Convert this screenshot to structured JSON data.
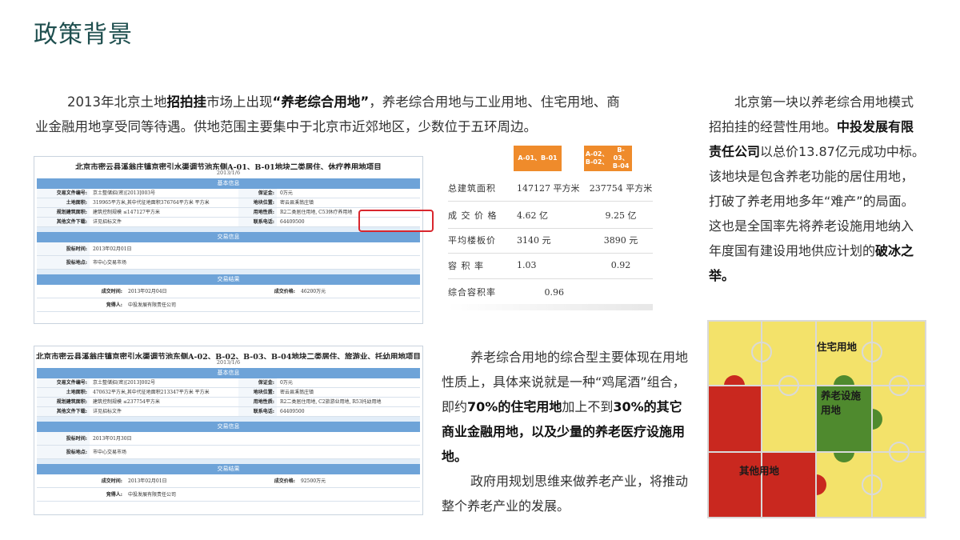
{
  "page": {
    "title": "政策背景",
    "intro": {
      "t1": "2013年北京土地",
      "b1": "招拍挂",
      "t2": "市场上出现",
      "b2": "“养老综合用地”",
      "t3": "，养老综合用地与工业用地、住宅用地、商业金融用地享受同等待遇。供地范围主要集中于北京市近郊地区，少数位于五环周边。"
    }
  },
  "doc1": {
    "title": "北京市密云县溪翁庄镇京密引水渠调节池东侧A-01、B-01地块二类居住、休疗养用地项目",
    "date": "2013/1/6",
    "band_basic": "基本信息",
    "band_trade": "交易信息",
    "band_result": "交易结果",
    "rows": {
      "file_no_label": "交易文件编号:",
      "file_no": "京土整储招(密)[2013]003号",
      "deposit_label": "保证金:",
      "deposit": "0万元",
      "area_label": "土地面积:",
      "area": "319965平方米,其中代征地面积376764平方米  平方米",
      "location_label": "地块位置:",
      "location": "密云县溪翁庄镇",
      "planning_label": "规划建筑面积:",
      "planning": "建筑控制规模 ≤147127平方米",
      "use_label": "用地性质:",
      "use": "R2二类居住用地,",
      "use_highlight": "C53休疗养用地",
      "download_label": "其他文件下载:",
      "download": "详见招标文件",
      "phone_label": "联系电话:",
      "phone": "64409500",
      "bid_time_label": "投标时间:",
      "bid_time": "2013年02月01日",
      "bid_place_label": "投标地点:",
      "bid_place": "市中心交易市场",
      "deal_time_label": "成交时间:",
      "deal_time": "2013年02月04日",
      "deal_price_label": "成交价格:",
      "deal_price": "46200万元",
      "winner_label": "竞得人:",
      "winner": "中投发展有限责任公司"
    }
  },
  "doc2": {
    "title": "北京市密云县溪翁庄镇京密引水渠调节池东侧A-02、B-02、B-03、B-04地块二类居住、旅游业、托幼用地项目",
    "date": "2013/1/6",
    "band_basic": "基本信息",
    "band_trade": "交易信息",
    "band_result": "交易结果",
    "rows": {
      "file_no_label": "交易文件编号:",
      "file_no": "京土整储招(密)[2013]002号",
      "deposit_label": "保证金:",
      "deposit": "0万元",
      "area_label": "土地面积:",
      "area": "470632平方米,其中代征地面积213347平方米  平方米",
      "location_label": "地块位置:",
      "location": "密云县溪翁庄镇",
      "planning_label": "规划建筑面积:",
      "planning": "建筑控制规模 ≤237754平方米",
      "use_label": "用地性质:",
      "use": "R2二类居住用地, C2旅游业用地, R53托幼用地",
      "download_label": "其他文件下载:",
      "download": "详见招标文件",
      "phone_label": "联系电话:",
      "phone": "64409500",
      "bid_time_label": "投标时间:",
      "bid_time": "2013年01月30日",
      "bid_place_label": "投标地点:",
      "bid_place": "市中心交易市场",
      "deal_time_label": "成交时间:",
      "deal_time": "2013年02月01日",
      "deal_price_label": "成交价格:",
      "deal_price": "92500万元",
      "winner_label": "竞得人:",
      "winner": "中投发展有限责任公司"
    }
  },
  "stats": {
    "head1": "A-01、B-01",
    "head2a": "A-02、B-02、",
    "head2b": "B-03、B-04",
    "rows": [
      {
        "label": "总建筑面积",
        "v1": "147127 平方米",
        "v2": "237754 平方米"
      },
      {
        "label": "成 交 价 格",
        "v1": "4.62 亿",
        "v2": "9.25 亿"
      },
      {
        "label": "平均楼板价",
        "v1": "3140 元",
        "v2": "3890 元"
      },
      {
        "label": "容  积  率",
        "v1": "1.03",
        "v2": "0.92"
      },
      {
        "label": "综合容积率",
        "v1": "0.96",
        "v2": ""
      }
    ]
  },
  "middle": {
    "p1_t1": "养老综合用地的综合型主要体现在用地性质上，具体来说就是一种“鸡尾酒”组合，即约",
    "p1_b1": "70%的住宅用地",
    "p1_t2": "加上不到",
    "p1_b2": "30%的其它商业金融用地，以及少量的养老医疗设施用地。",
    "p2": "政府用规划思维来做养老产业，将推动整个养老产业的发展。"
  },
  "right": {
    "t1": "北京第一块以养老综合用地模式招拍挂的经营性用地。",
    "b1": "中投发展有限责任公司",
    "t2": "以总价13.87亿元成功中标。该地块是包含养老功能的居住用地，打破了养老用地多年“难产”的局面。这也是全国率先将养老设施用地纳入年度国有建设用地供应计划的",
    "b2": "破冰之举。"
  },
  "puzzle": {
    "label_residential": "住宅用地",
    "label_elderly_a": "养老设施",
    "label_elderly_b": "用地",
    "label_other": "其他用地",
    "colors": {
      "yellow": "#f3e26a",
      "red": "#c9281f",
      "green": "#4f8a2e",
      "border": "#d9d9d9"
    }
  }
}
